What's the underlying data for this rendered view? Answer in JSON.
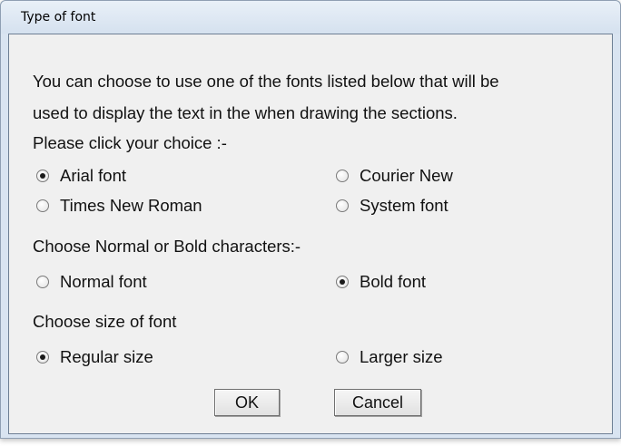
{
  "window": {
    "title": "Type of font"
  },
  "intro": [
    "You can choose to use one of the fonts listed below that will be",
    "used to display the text in the when drawing the sections.",
    "Please click your choice :-"
  ],
  "font_choice": {
    "options": [
      {
        "label": "Arial font",
        "checked": true
      },
      {
        "label": "Courier New",
        "checked": false
      },
      {
        "label": "Times New Roman",
        "checked": false
      },
      {
        "label": "System font",
        "checked": false
      }
    ]
  },
  "weight": {
    "heading": "Choose Normal or Bold characters:-",
    "options": [
      {
        "label": "Normal font",
        "checked": false
      },
      {
        "label": "Bold font",
        "checked": true
      }
    ]
  },
  "size": {
    "heading": "Choose size of font",
    "options": [
      {
        "label": "Regular size",
        "checked": true
      },
      {
        "label": "Larger size",
        "checked": false
      }
    ]
  },
  "buttons": {
    "ok": "OK",
    "cancel": "Cancel"
  }
}
